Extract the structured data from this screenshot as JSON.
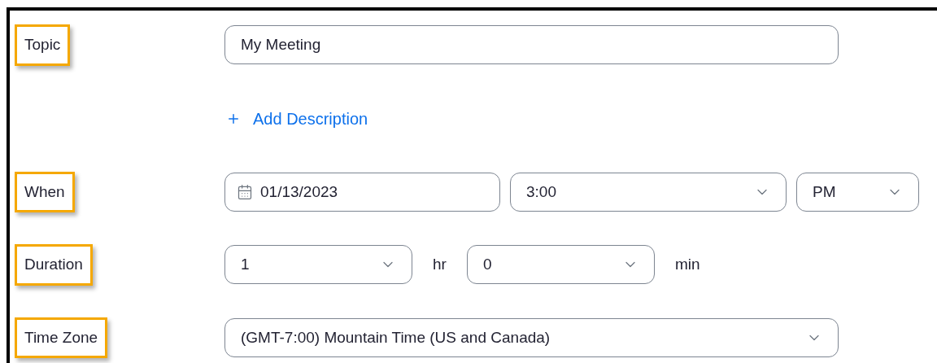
{
  "form": {
    "rows": [
      {
        "label": {
          "text": "Topic",
          "highlighted": true
        },
        "controls": [
          {
            "kind": "input",
            "value": "My Meeting"
          }
        ]
      },
      {
        "controls": [
          {
            "kind": "link",
            "text": "Add Description"
          }
        ]
      },
      {
        "label": {
          "text": "When",
          "highlighted": true
        },
        "controls": [
          {
            "kind": "date",
            "value": "01/13/2023"
          },
          {
            "kind": "select",
            "value": "3:00"
          },
          {
            "kind": "select",
            "value": "PM"
          }
        ]
      },
      {
        "label": {
          "text": "Duration",
          "highlighted": true
        },
        "controls": [
          {
            "kind": "select",
            "value": "1"
          },
          {
            "kind": "unit",
            "text": "hr"
          },
          {
            "kind": "select",
            "value": "0"
          },
          {
            "kind": "unit",
            "text": "min"
          }
        ]
      },
      {
        "label": {
          "text": "Time Zone",
          "highlighted": true
        },
        "controls": [
          {
            "kind": "select",
            "value": "(GMT-7:00) Mountain Time (US and Canada)"
          }
        ]
      }
    ]
  }
}
